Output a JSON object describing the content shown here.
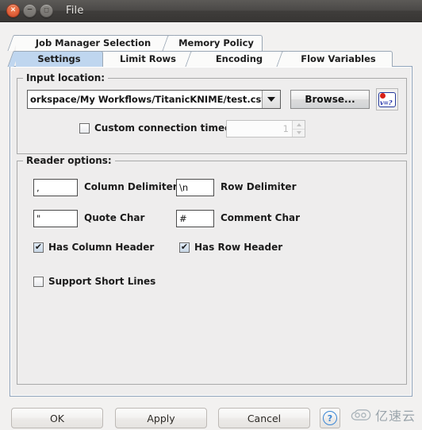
{
  "window": {
    "title": "File",
    "controls": {
      "close": "×",
      "minimize": "−",
      "maximize": "□"
    }
  },
  "tabs": {
    "row1": [
      {
        "label": "Job Manager Selection",
        "selected": false
      },
      {
        "label": "Memory Policy",
        "selected": false
      }
    ],
    "row2": [
      {
        "label": "Settings",
        "selected": true
      },
      {
        "label": "Limit Rows",
        "selected": false
      },
      {
        "label": "Encoding",
        "selected": false
      },
      {
        "label": "Flow Variables",
        "selected": false
      }
    ]
  },
  "input_location": {
    "group_title": "Input location:",
    "combo_value": "orkspace/My Workflows/TitanicKNIME/test.csv",
    "browse_label": "Browse...",
    "flow_variable_icon": "flow-variable-icon",
    "flow_variable_text": "v=?",
    "timeout": {
      "label": "Custom connection timeout [s]:",
      "checked": false,
      "value": "1",
      "enabled": false
    }
  },
  "reader_options": {
    "group_title": "Reader options:",
    "fields": [
      {
        "name": "column-delimiter",
        "value": ",",
        "label": "Column Delimiter"
      },
      {
        "name": "row-delimiter",
        "value": "\\n",
        "label": "Row Delimiter"
      },
      {
        "name": "quote-char",
        "value": "\"",
        "label": "Quote Char"
      },
      {
        "name": "comment-char",
        "value": "#",
        "label": "Comment Char"
      }
    ],
    "checkboxes": [
      {
        "name": "has-column-header",
        "label": "Has Column Header",
        "checked": true
      },
      {
        "name": "has-row-header",
        "label": "Has Row Header",
        "checked": true
      },
      {
        "name": "support-short-lines",
        "label": "Support Short Lines",
        "checked": false
      }
    ],
    "check_glyph": "✔"
  },
  "buttons": {
    "ok": "OK",
    "apply": "Apply",
    "cancel": "Cancel",
    "help": "?"
  },
  "watermark": {
    "text": "亿速云"
  },
  "colors": {
    "accent_tab": "#bfd6ef",
    "panel_bg": "#eeeded",
    "window_bg": "#f2f1f0",
    "titlebar": "#4b4947",
    "close_button": "#e2613a",
    "help_blue": "#3a86d4",
    "flow_var_red": "#d81f16",
    "flow_var_blue": "#1f2fa8"
  }
}
